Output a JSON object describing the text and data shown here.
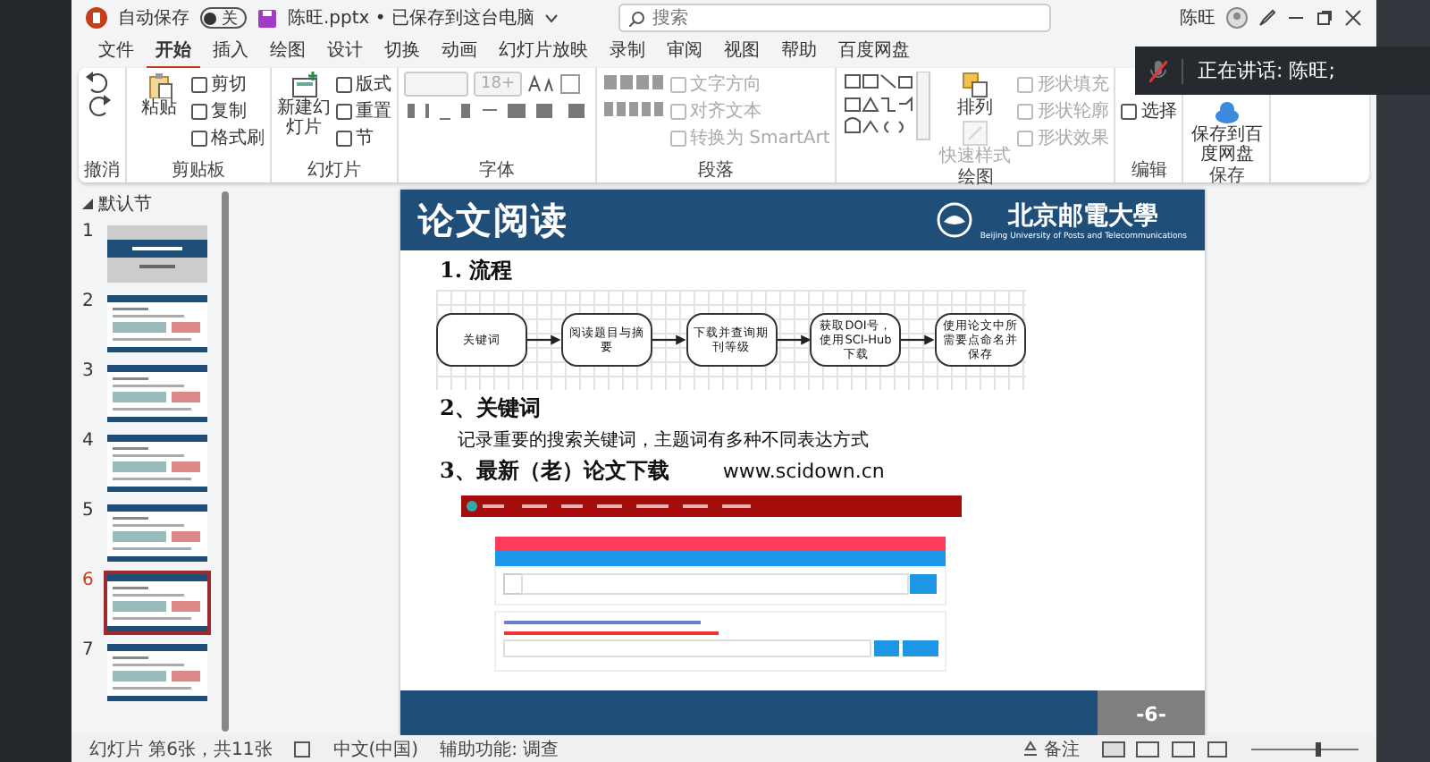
{
  "title_bar": {
    "autosave_label": "自动保存",
    "autosave_on": false,
    "autosave_state": "关",
    "file_title": "陈旺.pptx • 已保存到这台电脑",
    "search_placeholder": "搜索",
    "user": "陈旺"
  },
  "ribbon_tabs": [
    {
      "label": "文件",
      "selected": false
    },
    {
      "label": "开始",
      "selected": true
    },
    {
      "label": "插入",
      "selected": false
    },
    {
      "label": "绘图",
      "selected": false
    },
    {
      "label": "设计",
      "selected": false
    },
    {
      "label": "切换",
      "selected": false
    },
    {
      "label": "动画",
      "selected": false
    },
    {
      "label": "幻灯片放映",
      "selected": false
    },
    {
      "label": "录制",
      "selected": false
    },
    {
      "label": "审阅",
      "selected": false
    },
    {
      "label": "视图",
      "selected": false
    },
    {
      "label": "帮助",
      "selected": false
    },
    {
      "label": "百度网盘",
      "selected": false
    }
  ],
  "ribbon_groups": [
    {
      "label": "撤消",
      "kind": "undo"
    },
    {
      "label": "剪贴板",
      "kind": "commands",
      "commands": [
        {
          "label": "粘贴",
          "kind": "large",
          "disabled": false
        },
        {
          "label": "剪切",
          "kind": "small",
          "disabled": false
        },
        {
          "label": "复制",
          "kind": "small",
          "disabled": false
        },
        {
          "label": "格式刷",
          "kind": "small",
          "disabled": false
        }
      ]
    },
    {
      "label": "幻灯片",
      "kind": "commands",
      "commands": [
        {
          "label": "新建幻灯片",
          "kind": "large",
          "disabled": false
        },
        {
          "label": "版式",
          "kind": "small",
          "disabled": false
        },
        {
          "label": "重置",
          "kind": "small",
          "disabled": false
        },
        {
          "label": "节",
          "kind": "small",
          "disabled": false
        }
      ]
    },
    {
      "label": "字体",
      "kind": "font",
      "font_size": "18+"
    },
    {
      "label": "段落",
      "kind": "paragraph",
      "commands": [
        {
          "label": "文字方向",
          "kind": "small",
          "disabled": true
        },
        {
          "label": "对齐文本",
          "kind": "small",
          "disabled": true
        },
        {
          "label": "转换为 SmartArt",
          "kind": "small",
          "disabled": true
        }
      ]
    },
    {
      "label": "绘图",
      "kind": "drawing",
      "commands": [
        {
          "label": "排列",
          "kind": "large",
          "disabled": false
        },
        {
          "label": "快速样式",
          "kind": "large",
          "disabled": true
        },
        {
          "label": "形状填充",
          "kind": "small",
          "disabled": true
        },
        {
          "label": "形状轮廓",
          "kind": "small",
          "disabled": true
        },
        {
          "label": "形状效果",
          "kind": "small",
          "disabled": true
        }
      ]
    },
    {
      "label": "编辑",
      "kind": "commands",
      "commands": [
        {
          "label": "选择",
          "kind": "small",
          "disabled": false
        }
      ]
    },
    {
      "label": "保存",
      "kind": "commands",
      "commands": [
        {
          "label": "保存到百度网盘",
          "kind": "large",
          "disabled": false
        }
      ]
    }
  ],
  "speaker_overlay": {
    "text": "正在讲话: 陈旺;"
  },
  "slides_panel": {
    "section": "默认节",
    "slides": [
      {
        "number": "1",
        "kind": "title",
        "selected": false
      },
      {
        "number": "2",
        "kind": "content",
        "selected": false
      },
      {
        "number": "3",
        "kind": "content",
        "selected": false
      },
      {
        "number": "4",
        "kind": "content",
        "selected": false
      },
      {
        "number": "5",
        "kind": "content",
        "selected": false
      },
      {
        "number": "6",
        "kind": "content",
        "selected": true
      },
      {
        "number": "7",
        "kind": "content",
        "selected": false
      }
    ]
  },
  "slide": {
    "title": "论文阅读",
    "logo_text": "北京邮電大學",
    "logo_subtitle": "Beijing University of Posts and Telecommunications",
    "heading_1": "1.  流程",
    "flow": [
      "关键词",
      "阅读题目与摘要",
      "下载并查询期刊等级",
      "获取DOI号，使用SCI-Hub下载",
      "使用论文中所需要点命名并保存"
    ],
    "heading_2": "2、关键词",
    "body_2": "记录重要的搜索关键词，主题词有多种不同表达方式",
    "heading_3": "3、最新（老）论文下载",
    "url": "www.scidown.cn",
    "page_number": "-6-"
  },
  "status_bar": {
    "slide_info": "幻灯片 第6张，共11张",
    "language": "中文(中国)",
    "accessibility": "辅助功能: 调查",
    "notes": "备注"
  }
}
